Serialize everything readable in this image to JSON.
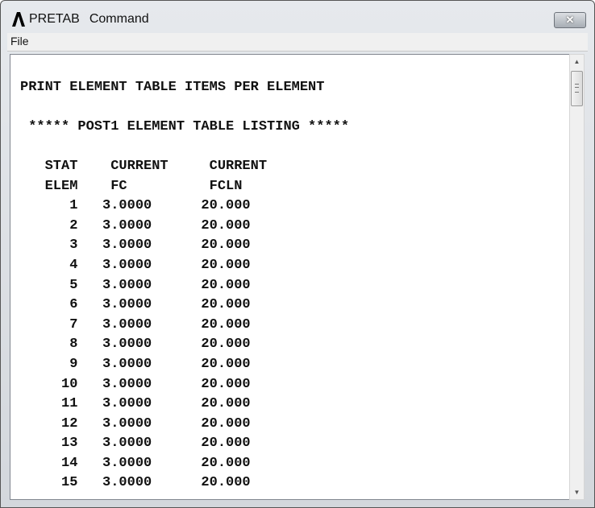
{
  "window": {
    "app": "PRETAB",
    "title": "Command",
    "close_label": "✕"
  },
  "menu": {
    "file": "File"
  },
  "listing": {
    "heading": "PRINT ELEMENT TABLE ITEMS PER ELEMENT",
    "subheading": "***** POST1 ELEMENT TABLE LISTING *****",
    "header1": [
      "STAT",
      "CURRENT",
      "CURRENT"
    ],
    "header2": [
      "ELEM",
      "FC",
      "FCLN"
    ],
    "rows": [
      [
        "1",
        "3.0000",
        "20.000"
      ],
      [
        "2",
        "3.0000",
        "20.000"
      ],
      [
        "3",
        "3.0000",
        "20.000"
      ],
      [
        "4",
        "3.0000",
        "20.000"
      ],
      [
        "5",
        "3.0000",
        "20.000"
      ],
      [
        "6",
        "3.0000",
        "20.000"
      ],
      [
        "7",
        "3.0000",
        "20.000"
      ],
      [
        "8",
        "3.0000",
        "20.000"
      ],
      [
        "9",
        "3.0000",
        "20.000"
      ],
      [
        "10",
        "3.0000",
        "20.000"
      ],
      [
        "11",
        "3.0000",
        "20.000"
      ],
      [
        "12",
        "3.0000",
        "20.000"
      ],
      [
        "13",
        "3.0000",
        "20.000"
      ],
      [
        "14",
        "3.0000",
        "20.000"
      ],
      [
        "15",
        "3.0000",
        "20.000"
      ]
    ]
  },
  "scrollbar": {
    "up": "▲",
    "down": "▼"
  }
}
